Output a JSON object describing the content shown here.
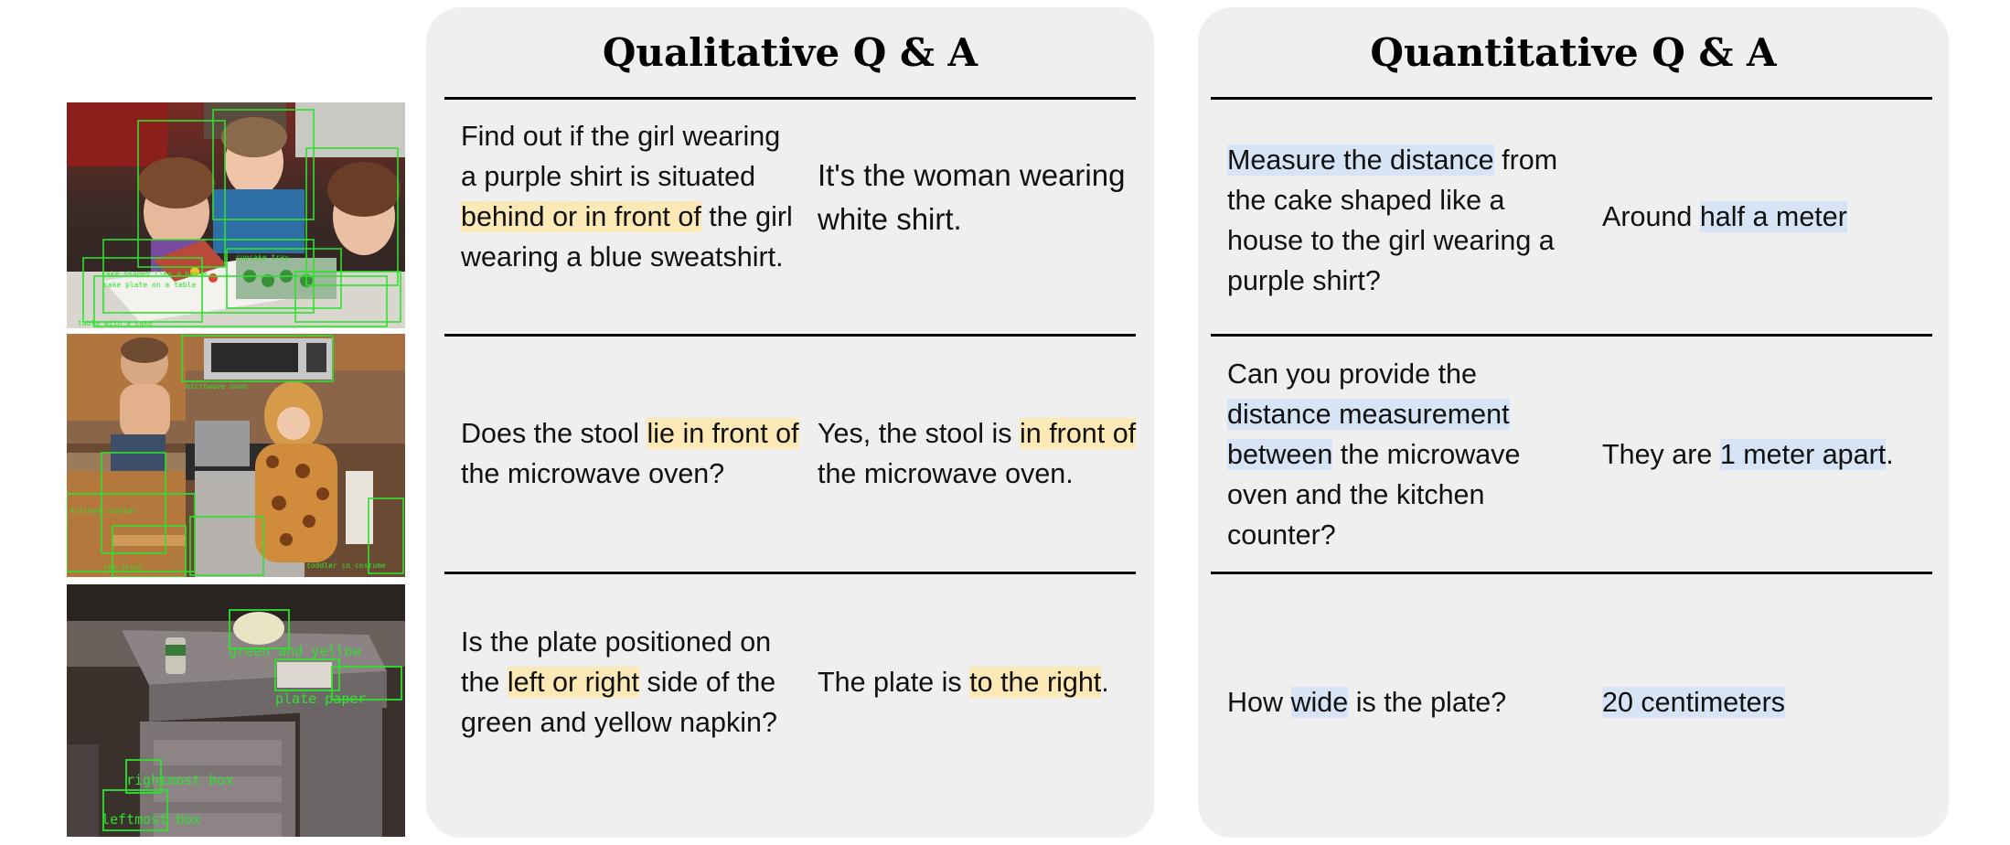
{
  "images": [
    {
      "name": "birthday-cake-scene",
      "box_labels": [
        "cake shaped like a house",
        "cake plate on a table",
        "cupcake tray",
        "table with a cake"
      ]
    },
    {
      "name": "kitchen-scene",
      "box_labels": [
        "microwave oven",
        "the stool",
        "kitchen counter",
        "toddler in costume"
      ]
    },
    {
      "name": "plate-scene",
      "box_labels": [
        "green and yellow",
        "plate paper",
        "rightmost box",
        "leftmost box"
      ]
    }
  ],
  "qualitative": {
    "title": "Qualitative Q & A",
    "rows": [
      {
        "question": [
          {
            "text": "Find out if the girl wearing a purple shirt is situated "
          },
          {
            "text": "behind or in front of",
            "hl": true
          },
          {
            "text": " the girl wearing a blue sweatshirt."
          }
        ],
        "answer": [
          {
            "text": "It's the woman wearing white shirt."
          }
        ]
      },
      {
        "question": [
          {
            "text": "Does the stool "
          },
          {
            "text": "lie in front of",
            "hl": true
          },
          {
            "text": " the microwave oven?"
          }
        ],
        "answer": [
          {
            "text": "Yes, the stool is "
          },
          {
            "text": "in front of",
            "hl": true
          },
          {
            "text": " the microwave oven."
          }
        ]
      },
      {
        "question": [
          {
            "text": "Is the plate positioned on the "
          },
          {
            "text": "left or right",
            "hl": true
          },
          {
            "text": " side of the green and yellow napkin?"
          }
        ],
        "answer": [
          {
            "text": "The plate is "
          },
          {
            "text": "to the right",
            "hl": true
          },
          {
            "text": "."
          }
        ]
      }
    ]
  },
  "quantitative": {
    "title": "Quantitative Q & A",
    "rows": [
      {
        "question": [
          {
            "text": "Measure the distance",
            "hl": true
          },
          {
            "text": " from the cake shaped like a house to the girl wearing a purple shirt?"
          }
        ],
        "answer": [
          {
            "text": "Around "
          },
          {
            "text": "half a meter",
            "hl": true
          }
        ]
      },
      {
        "question": [
          {
            "text": "Can you provide the "
          },
          {
            "text": "distance measurement between",
            "hl": true
          },
          {
            "text": " the microwave oven and the kitchen counter?"
          }
        ],
        "answer": [
          {
            "text": "They are "
          },
          {
            "text": "1 meter apart",
            "hl": true
          },
          {
            "text": "."
          }
        ]
      },
      {
        "question": [
          {
            "text": "How "
          },
          {
            "text": "wide",
            "hl": true
          },
          {
            "text": " is the plate?"
          }
        ],
        "answer": [
          {
            "text": "20 centimeters",
            "hl": true
          }
        ]
      }
    ]
  }
}
